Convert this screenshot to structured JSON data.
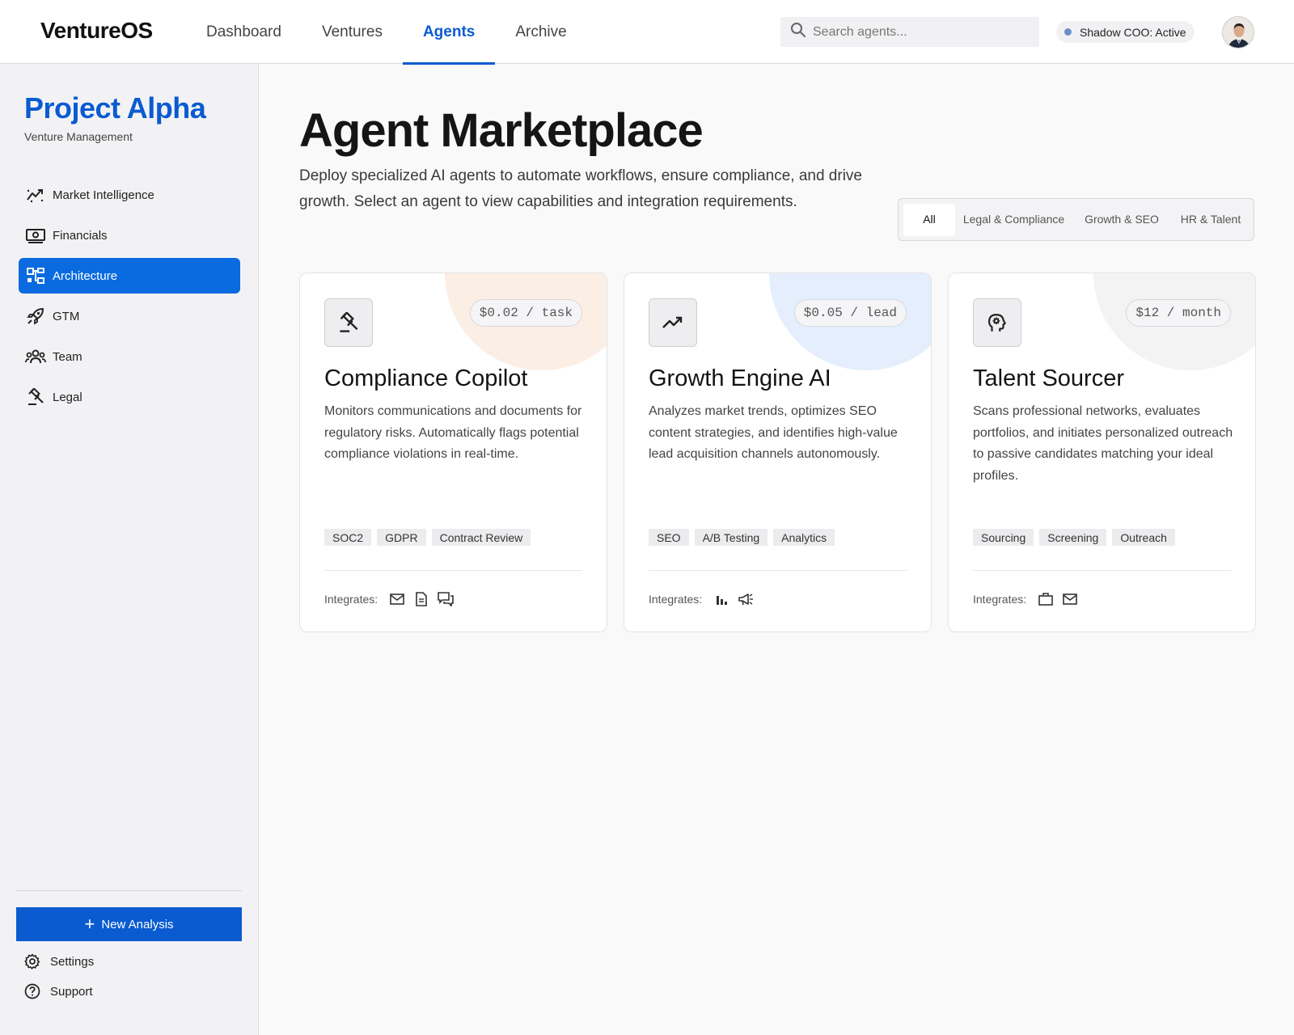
{
  "app": {
    "logo": "VentureOS"
  },
  "nav": {
    "items": [
      {
        "label": "Dashboard"
      },
      {
        "label": "Ventures"
      },
      {
        "label": "Agents"
      },
      {
        "label": "Archive"
      }
    ],
    "active": "Agents"
  },
  "search": {
    "placeholder": "Search agents...",
    "value": ""
  },
  "status": {
    "label": "Shadow COO: Active",
    "dot_color": "#6a8fc7"
  },
  "sidebar": {
    "project_title": "Project Alpha",
    "project_subtitle": "Venture Management",
    "items": [
      {
        "label": "Market Intelligence",
        "icon": "trend-chart-icon"
      },
      {
        "label": "Financials",
        "icon": "cash-icon"
      },
      {
        "label": "Architecture",
        "icon": "hierarchy-icon",
        "active": true
      },
      {
        "label": "GTM",
        "icon": "rocket-icon"
      },
      {
        "label": "Team",
        "icon": "group-icon"
      },
      {
        "label": "Legal",
        "icon": "gavel-icon"
      }
    ],
    "new_button": "New Analysis",
    "settings": "Settings",
    "support": "Support"
  },
  "main": {
    "title": "Agent Marketplace",
    "description": "Deploy specialized AI agents to automate workflows, ensure compliance, and drive growth. Select an agent to view capabilities and integration requirements.",
    "filters": [
      "All",
      "Legal & Compliance",
      "Growth & SEO",
      "HR & Talent"
    ],
    "active_filter": "All"
  },
  "cards": [
    {
      "title": "Compliance Copilot",
      "price": "$0.02 / task",
      "icon": "gavel-icon",
      "accent": "#fbeee4",
      "description": "Monitors communications and documents for regulatory risks. Automatically flags potential compliance violations in real-time.",
      "tags": [
        "SOC2",
        "GDPR",
        "Contract Review"
      ],
      "integrates_label": "Integrates:",
      "integrations": [
        "mail-icon",
        "document-icon",
        "chat-icon"
      ]
    },
    {
      "title": "Growth Engine AI",
      "price": "$0.05 / lead",
      "icon": "trending-up-icon",
      "accent": "#e4eefc",
      "description": "Analyzes market trends, optimizes SEO content strategies, and identifies high-value lead acquisition channels autonomously.",
      "tags": [
        "SEO",
        "A/B Testing",
        "Analytics"
      ],
      "integrates_label": "Integrates:",
      "integrations": [
        "bar-chart-icon",
        "megaphone-icon"
      ]
    },
    {
      "title": "Talent Sourcer",
      "price": "$12 / month",
      "icon": "head-gear-icon",
      "accent": "#f3f3f4",
      "description": "Scans professional networks, evaluates portfolios, and initiates personalized outreach to passive candidates matching your ideal profiles.",
      "tags": [
        "Sourcing",
        "Screening",
        "Outreach"
      ],
      "integrates_label": "Integrates:",
      "integrations": [
        "briefcase-icon",
        "mail-icon"
      ]
    }
  ],
  "colors": {
    "accent": "#0a5bd0",
    "sidebar_active": "#0a6be0"
  }
}
